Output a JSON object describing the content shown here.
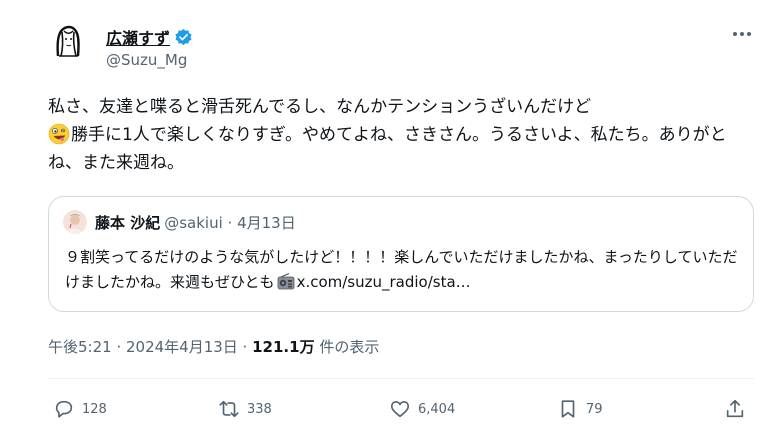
{
  "author": {
    "name": "広瀬すず",
    "handle": "@Suzu_Mg"
  },
  "tweet": {
    "text_part1": "私さ、友達と喋ると滑舌死んでるし、なんかテンションうざいんだけど",
    "text_part2": "勝手に1人で楽しくなりすぎ。やめてよね、さきさん。うるさいよ、私たち。ありがとね、また来週ね。",
    "emoji_icon": "zany-face-icon"
  },
  "quote": {
    "name": "藤本 沙紀",
    "handle_date": "@sakiui · 4月13日",
    "text_part1": "９割笑ってるだけのような気がしたけど！！！！楽しんでいただけましたかね、まったりしていただけましたかね。来週もぜひとも",
    "text_link": "x.com/suzu_radio/sta…",
    "radio_icon": "radio-icon"
  },
  "meta": {
    "time_date": "午後5:21 · 2024年4月13日 ·",
    "views_count": "121.1万",
    "views_label": "件の表示"
  },
  "actions": {
    "replies": "128",
    "reposts": "338",
    "likes": "6,404",
    "bookmarks": "79"
  },
  "colors": {
    "verified": "#1d9bf0",
    "secondary_text": "#536471",
    "border": "#cfd9de"
  }
}
